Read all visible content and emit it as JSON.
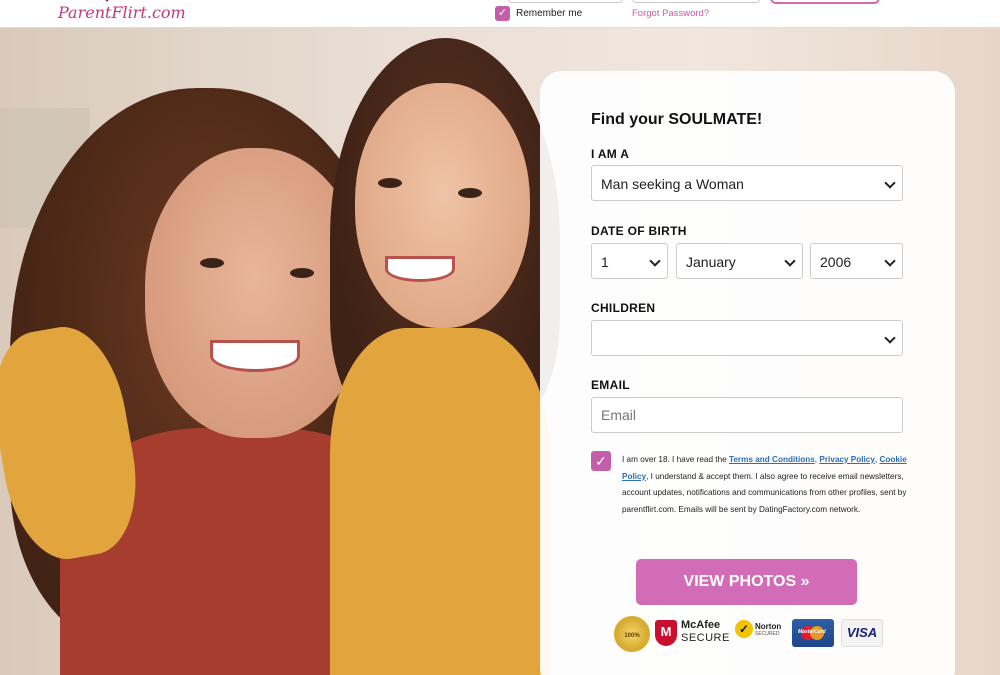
{
  "header": {
    "logo_text": "ParentFlirt.com",
    "remember_label": "Remember me",
    "forgot_link": "Forgot Password?"
  },
  "form": {
    "title": "Find your SOULMATE!",
    "i_am_a": {
      "label": "I AM A",
      "value": "Man seeking a Woman"
    },
    "dob": {
      "label": "DATE OF BIRTH",
      "day": "1",
      "month": "January",
      "year": "2006"
    },
    "children": {
      "label": "CHILDREN",
      "value": ""
    },
    "email": {
      "label": "EMAIL",
      "placeholder": "Email",
      "value": ""
    },
    "terms": {
      "checked": true,
      "text_1": "I am over 18. I have read the ",
      "link_terms": "Terms and Conditions",
      "sep_1": ", ",
      "link_privacy": "Privacy Policy",
      "sep_2": ", ",
      "link_cookie": "Cookie Policy",
      "text_2": ", I understand & accept them. I also agree to receive email newsletters, account updates, notifications and communications from other profiles, sent by parentflirt.com. Emails will be sent by DatingFactory.com network."
    },
    "submit_label": "VIEW PHOTOS »"
  },
  "badges": {
    "guarantee": "100%",
    "mcafee_name": "McAfee",
    "mcafee_sub": "SECURE",
    "norton_name": "Norton",
    "norton_sub": "SECURED",
    "mastercard": "MasterCard",
    "visa": "VISA"
  },
  "colors": {
    "accent": "#d36cb7",
    "checkbox": "#c45eaa",
    "link": "#2a6fb8"
  }
}
